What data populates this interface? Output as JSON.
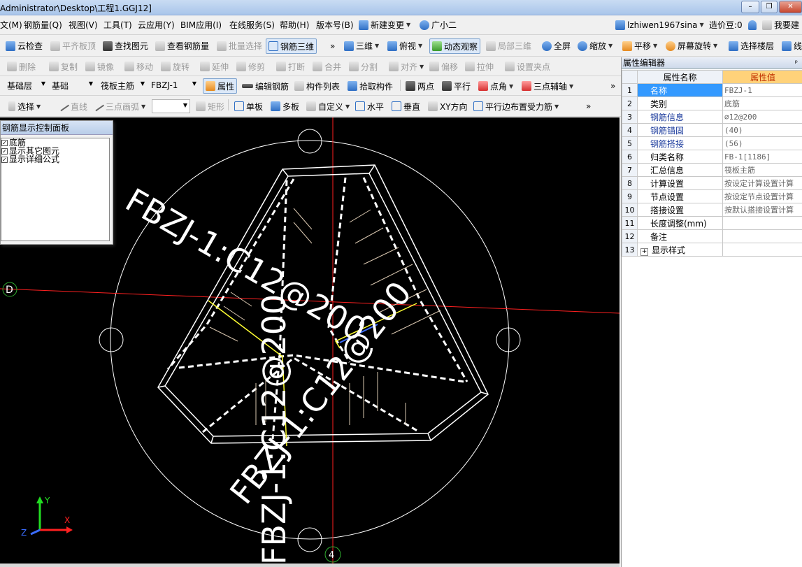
{
  "window": {
    "title": "Administrator\\Desktop\\工程1.GGJ12]",
    "min": "–",
    "max": "❐",
    "close": "✕"
  },
  "menu": {
    "items": [
      "文(M)",
      "钢筋量(Q)",
      "视图(V)",
      "工具(T)",
      "云应用(Y)",
      "BIM应用(I)",
      "在线服务(S)",
      "帮助(H)",
      "版本号(B)",
      "新建变更",
      "广小二"
    ],
    "user": "lzhiwen1967sina",
    "coins": "造价豆:0",
    "help": "我要建"
  },
  "toolbar1": {
    "cloud_check": "云检查",
    "flush_top": "平齐板顶",
    "find_elem": "查找图元",
    "view_qty": "查看钢筋量",
    "batch_select": "批量选择",
    "rebar_3d": "钢筋三维",
    "three_d": "三维",
    "top_view": "俯视",
    "dynamic_view": "动态观察",
    "local_3d": "局部三维",
    "full_screen": "全屏",
    "zoom": "缩放",
    "pan": "平移",
    "screen_rotate": "屏幕旋转",
    "select_floor": "选择楼层",
    "more": "线"
  },
  "toolbar2": {
    "delete": "删除",
    "copy": "复制",
    "mirror": "镜像",
    "move": "移动",
    "rotate": "旋转",
    "extend": "延伸",
    "trim": "修剪",
    "break": "打断",
    "merge": "合并",
    "split": "分割",
    "align": "对齐",
    "offset": "偏移",
    "stretch": "拉伸",
    "set_grip": "设置夹点"
  },
  "toolbar3": {
    "floor": "基础层",
    "category": "基础",
    "type": "筏板主筋",
    "element": "FBZJ-1",
    "property": "属性",
    "edit_rebar": "编辑钢筋",
    "member_list": "构件列表",
    "pick": "拾取构件",
    "two_points": "两点",
    "parallel": "平行",
    "corner": "点角",
    "three_point_axis": "三点辅轴"
  },
  "toolbar4": {
    "select": "选择",
    "line": "直线",
    "arc": "三点画弧",
    "rect": "矩形",
    "single_board": "单板",
    "multi_board": "多板",
    "custom": "自定义",
    "horizontal": "水平",
    "vertical": "垂直",
    "xy_dir": "XY方向",
    "parallel_edge": "平行边布置受力筋"
  },
  "control_panel": {
    "title": "钢筋显示控制面板",
    "options": [
      {
        "label": "底筋",
        "checked": true
      },
      {
        "label": "显示其它图元",
        "checked": true
      },
      {
        "label": "显示详细公式",
        "checked": true
      }
    ]
  },
  "canvas": {
    "label1": "FBZJ-1:C12@200",
    "label2": "FBZJ-1:C12@200",
    "label3": "FBZJ-1:C12@200",
    "axis_d": "D",
    "axis_4": "4",
    "coord_x": "X",
    "coord_y": "Y",
    "coord_z": "Z"
  },
  "properties": {
    "title": "属性编辑器",
    "pin": "ᵖ",
    "header_name": "属性名称",
    "header_value": "属性值",
    "rows": [
      {
        "n": "1",
        "name": "名称",
        "value": "FBZJ-1"
      },
      {
        "n": "2",
        "name": "类别",
        "value": "底筋"
      },
      {
        "n": "3",
        "name": "钢筋信息",
        "value": "⌀12@200"
      },
      {
        "n": "4",
        "name": "钢筋锚固",
        "value": "(40)"
      },
      {
        "n": "5",
        "name": "钢筋搭接",
        "value": "(56)"
      },
      {
        "n": "6",
        "name": "归类名称",
        "value": "FB-1[1186]"
      },
      {
        "n": "7",
        "name": "汇总信息",
        "value": "筏板主筋"
      },
      {
        "n": "8",
        "name": "计算设置",
        "value": "按设定计算设置计算"
      },
      {
        "n": "9",
        "name": "节点设置",
        "value": "按设定节点设置计算"
      },
      {
        "n": "10",
        "name": "搭接设置",
        "value": "按默认搭接设置计算"
      },
      {
        "n": "11",
        "name": "长度调整(mm)",
        "value": ""
      },
      {
        "n": "12",
        "name": "备注",
        "value": ""
      },
      {
        "n": "13",
        "name": "显示样式",
        "value": ""
      }
    ]
  }
}
